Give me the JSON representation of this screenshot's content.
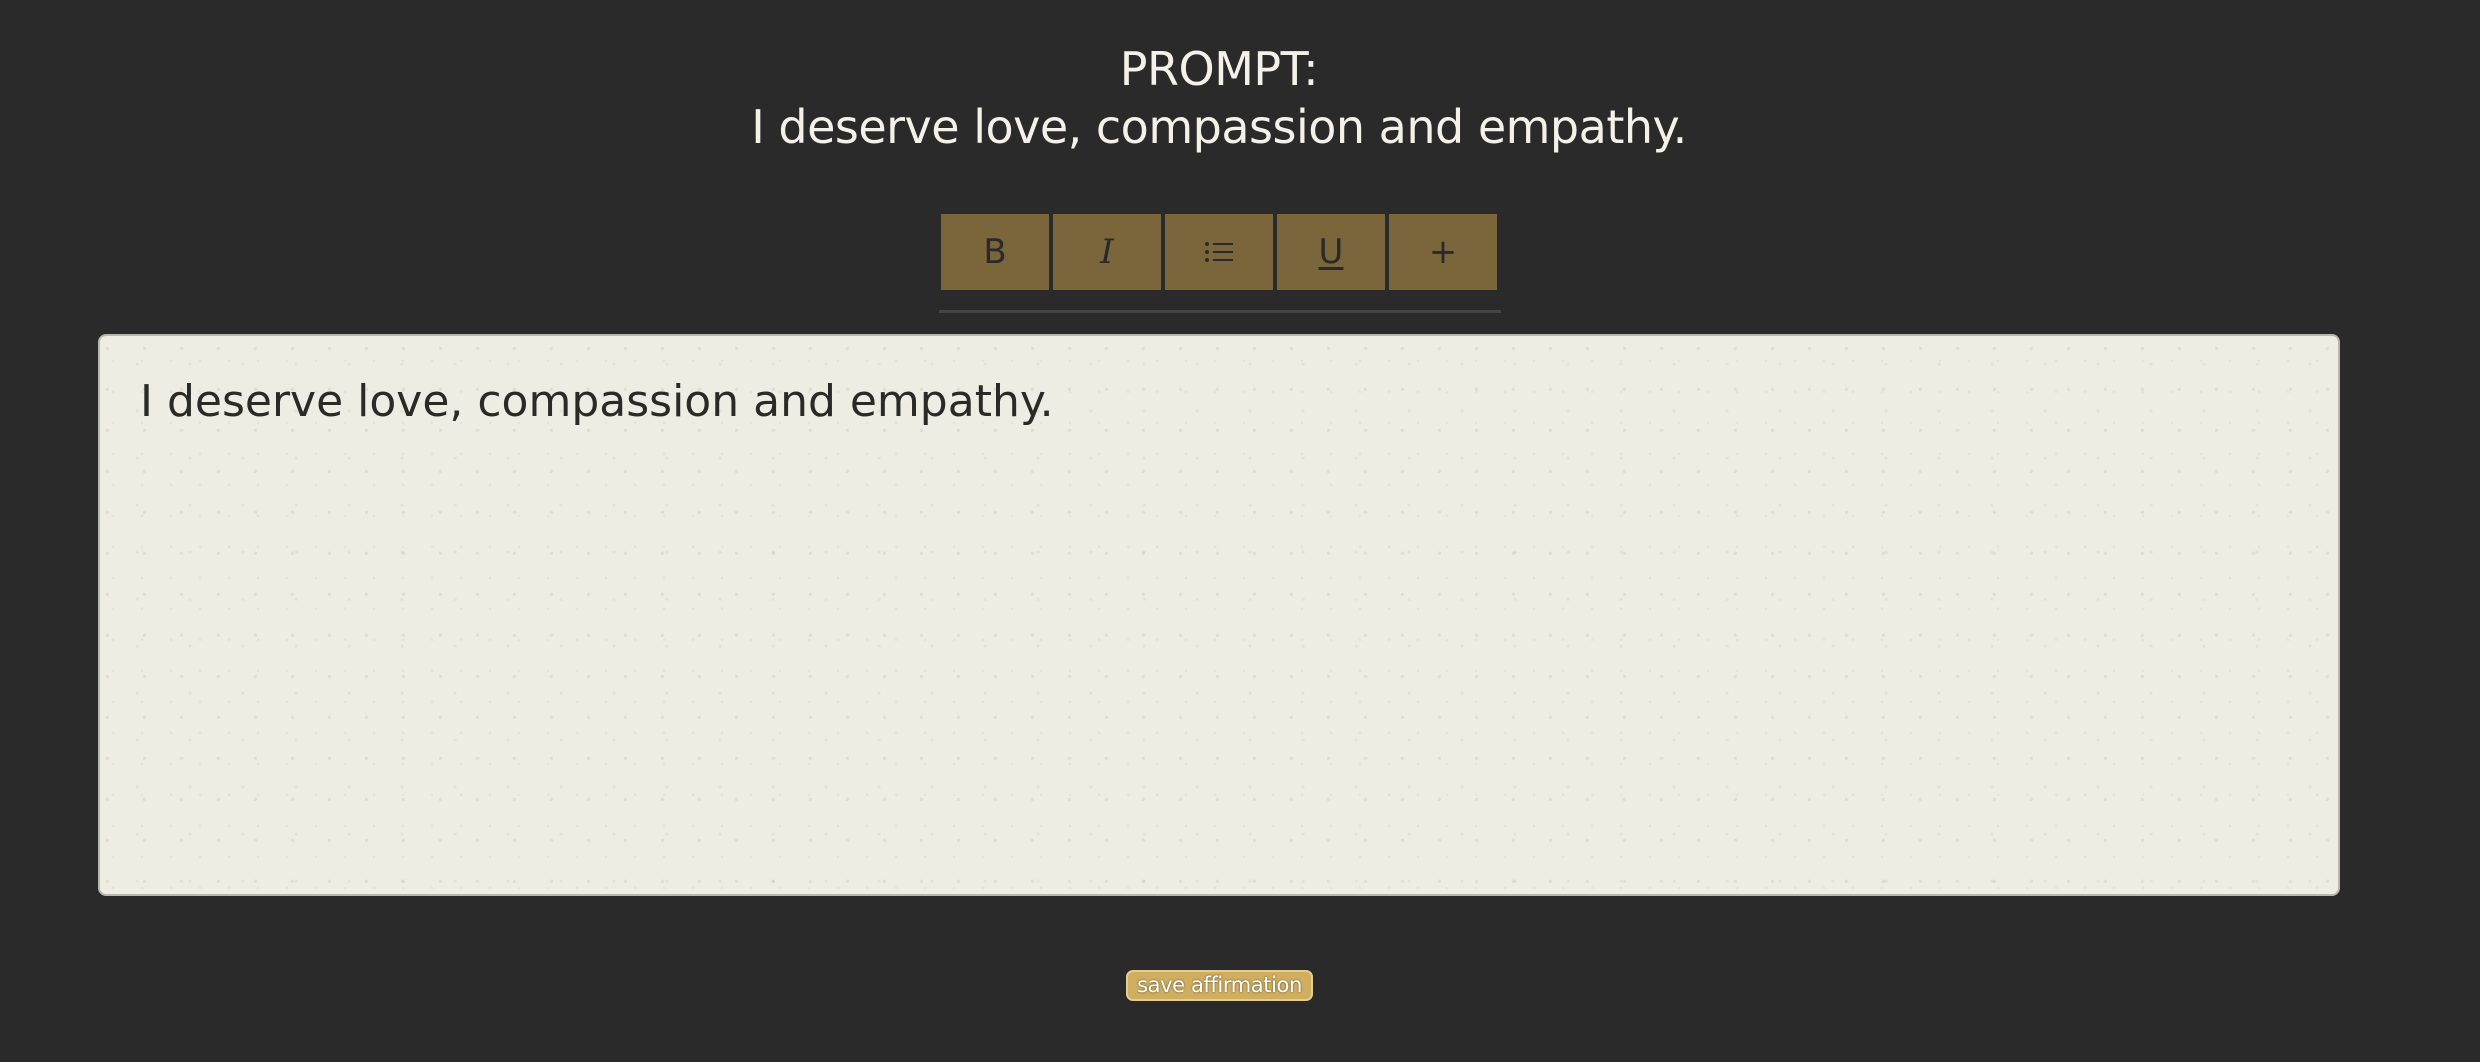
{
  "prompt": {
    "heading": "PROMPT:",
    "text": "I deserve love, compassion and empathy."
  },
  "toolbar": {
    "bold_label": "B",
    "italic_label": "I",
    "list_label": "⁝☰",
    "underline_label": "U",
    "add_label": "+"
  },
  "editor": {
    "content": "I deserve love, compassion and empathy."
  },
  "actions": {
    "save_label": "save affirmation"
  },
  "colors": {
    "background": "#2a2a2a",
    "toolbar_button": "#7b653a",
    "editor_paper": "#efede3",
    "save_button": "#cfae60"
  }
}
